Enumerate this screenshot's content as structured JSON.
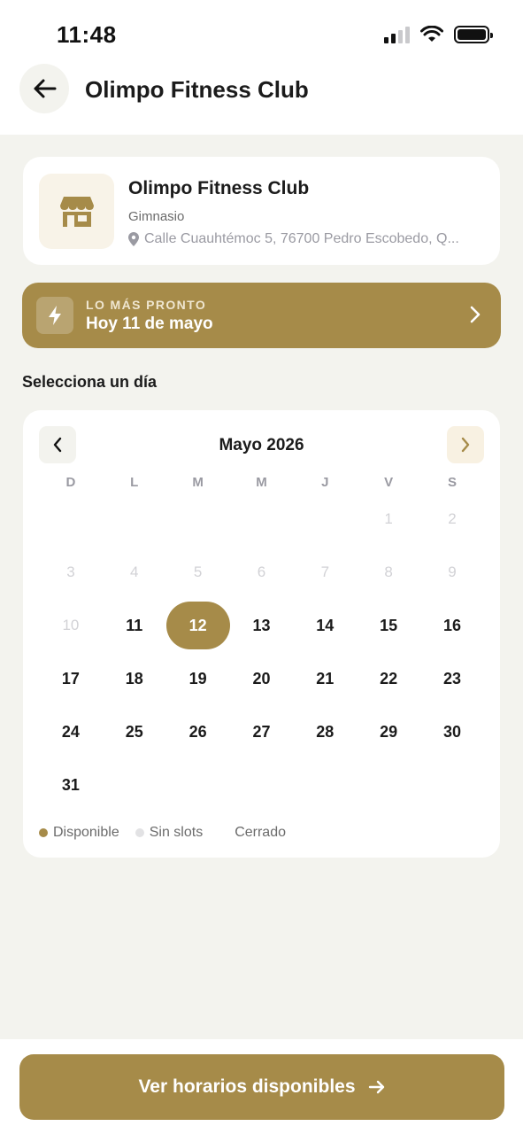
{
  "status_bar": {
    "time": "11:48"
  },
  "header": {
    "title": "Olimpo Fitness Club"
  },
  "business": {
    "name": "Olimpo Fitness Club",
    "type": "Gimnasio",
    "address": "Calle Cuauhtémoc 5, 76700 Pedro Escobedo, Q..."
  },
  "soonest": {
    "label": "LO MÁS PRONTO",
    "value": "Hoy 11 de mayo"
  },
  "section_title": "Selecciona un día",
  "calendar": {
    "month_label": "Mayo 2026",
    "weekdays": [
      "D",
      "L",
      "M",
      "M",
      "J",
      "V",
      "S"
    ],
    "weeks": [
      [
        null,
        null,
        null,
        null,
        null,
        "1",
        "2"
      ],
      [
        "3",
        "4",
        "5",
        "6",
        "7",
        "8",
        "9"
      ],
      [
        "10",
        "11",
        "12",
        "13",
        "14",
        "15",
        "16"
      ],
      [
        "17",
        "18",
        "19",
        "20",
        "21",
        "22",
        "23"
      ],
      [
        "24",
        "25",
        "26",
        "27",
        "28",
        "29",
        "30"
      ],
      [
        "31",
        null,
        null,
        null,
        null,
        null,
        null
      ]
    ],
    "disabled_days": [
      "1",
      "2",
      "3",
      "4",
      "5",
      "6",
      "7",
      "8",
      "9",
      "10"
    ],
    "selected_day": "12"
  },
  "legend": {
    "available": "Disponible",
    "no_slots": "Sin slots",
    "closed": "Cerrado"
  },
  "cta": {
    "label": "Ver horarios disponibles"
  },
  "colors": {
    "accent": "#a68b49",
    "background": "#f3f3ee",
    "muted": "#9a9aa2",
    "disabled": "#d2d2d6",
    "no_slots_dot": "#e2e2e4"
  },
  "icons": {
    "back": "arrow-left-icon",
    "store": "store-icon",
    "location": "location-pin-icon",
    "bolt": "bolt-icon",
    "chevron_right": "chevron-right-icon",
    "chevron_left": "chevron-left-icon",
    "arrow_right": "arrow-right-icon"
  }
}
